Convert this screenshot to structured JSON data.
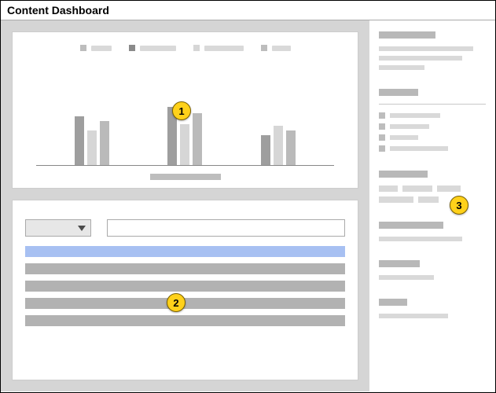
{
  "window": {
    "title": "Content Dashboard"
  },
  "chart_data": {
    "type": "bar",
    "series_colors": [
      "#9e9e9e",
      "#d6d6d6",
      "#bababa"
    ],
    "legend": [
      {
        "swatch": "#bdbdbd",
        "label_width": 26,
        "label_color": "#d9d9d9"
      },
      {
        "swatch": "#8a8a8a",
        "label_width": 46,
        "label_color": "#d9d9d9"
      },
      {
        "swatch": "#d6d6d6",
        "label_width": 50,
        "label_color": "#d9d9d9"
      },
      {
        "swatch": "#bdbdbd",
        "label_width": 24,
        "label_color": "#d9d9d9"
      }
    ],
    "groups": [
      {
        "bars": [
          62,
          44,
          56
        ]
      },
      {
        "bars": [
          74,
          52,
          66
        ]
      },
      {
        "bars": [
          38,
          50,
          44
        ]
      }
    ],
    "caption_placeholder": true
  },
  "table": {
    "filter_dropdown": "",
    "search_value": "",
    "rows": [
      "header",
      "body",
      "body",
      "body",
      "body"
    ]
  },
  "sidebar": {
    "blocks": [
      {
        "type": "heading-lines",
        "head_w": 72,
        "lines": [
          120,
          106,
          58
        ]
      },
      {
        "type": "list",
        "head_w": 50,
        "rule": true,
        "items": [
          64,
          50,
          36,
          74
        ]
      },
      {
        "type": "tags",
        "head_w": 62,
        "tags": [
          24,
          38,
          30,
          44,
          26
        ]
      },
      {
        "type": "heading-lines",
        "head_w": 82,
        "lines": [
          106
        ]
      },
      {
        "type": "heading-lines",
        "head_w": 52,
        "lines": [
          70
        ]
      },
      {
        "type": "heading-lines",
        "head_w": 36,
        "lines": [
          88
        ]
      }
    ]
  },
  "annotations": [
    {
      "n": "1",
      "area": "chart"
    },
    {
      "n": "2",
      "area": "table"
    },
    {
      "n": "3",
      "area": "sidebar"
    }
  ]
}
